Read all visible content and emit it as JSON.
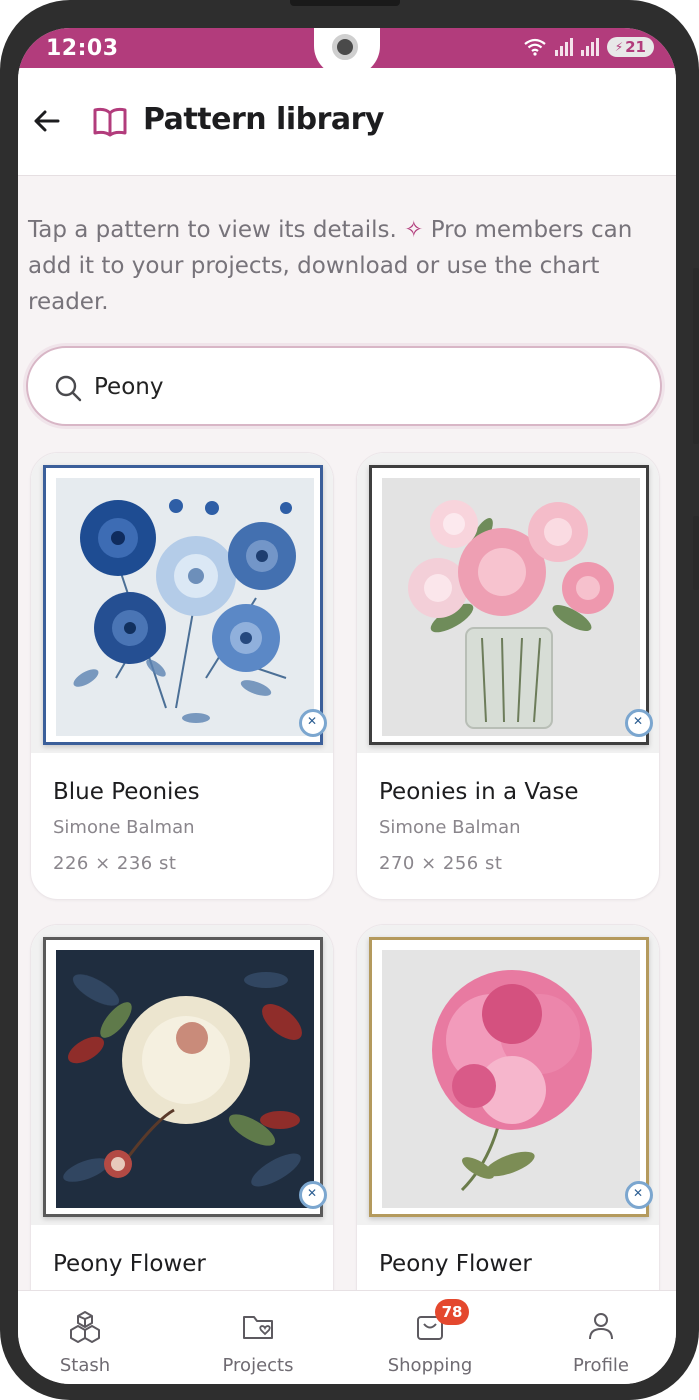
{
  "status_bar": {
    "time": "12:03",
    "battery": "21",
    "accent_color": "#b23c7c"
  },
  "header": {
    "title": "Pattern library",
    "back_icon": "arrow-left-icon",
    "title_icon": "book-icon"
  },
  "intro": {
    "text_before": "Tap a pattern to view its details. ",
    "sparkle_icon": "sparkle-icon",
    "text_after": " Pro members can add it to your projects, download or use the chart reader."
  },
  "search": {
    "value": "Peony",
    "icon": "search-icon"
  },
  "patterns": [
    {
      "name": "Blue Peonies",
      "author": "Simone Balman",
      "size": "226 × 236 st"
    },
    {
      "name": "Peonies in a Vase",
      "author": "Simone Balman",
      "size": "270 × 256 st"
    },
    {
      "name": "Peony Flower",
      "author": "",
      "size": ""
    },
    {
      "name": "Peony Flower",
      "author": "",
      "size": ""
    }
  ],
  "bottom_nav": {
    "items": [
      {
        "label": "Stash",
        "icon": "cubes-icon"
      },
      {
        "label": "Projects",
        "icon": "folder-heart-icon"
      },
      {
        "label": "Shopping",
        "icon": "shopping-bag-icon",
        "badge": "78"
      },
      {
        "label": "Profile",
        "icon": "person-icon"
      }
    ]
  }
}
